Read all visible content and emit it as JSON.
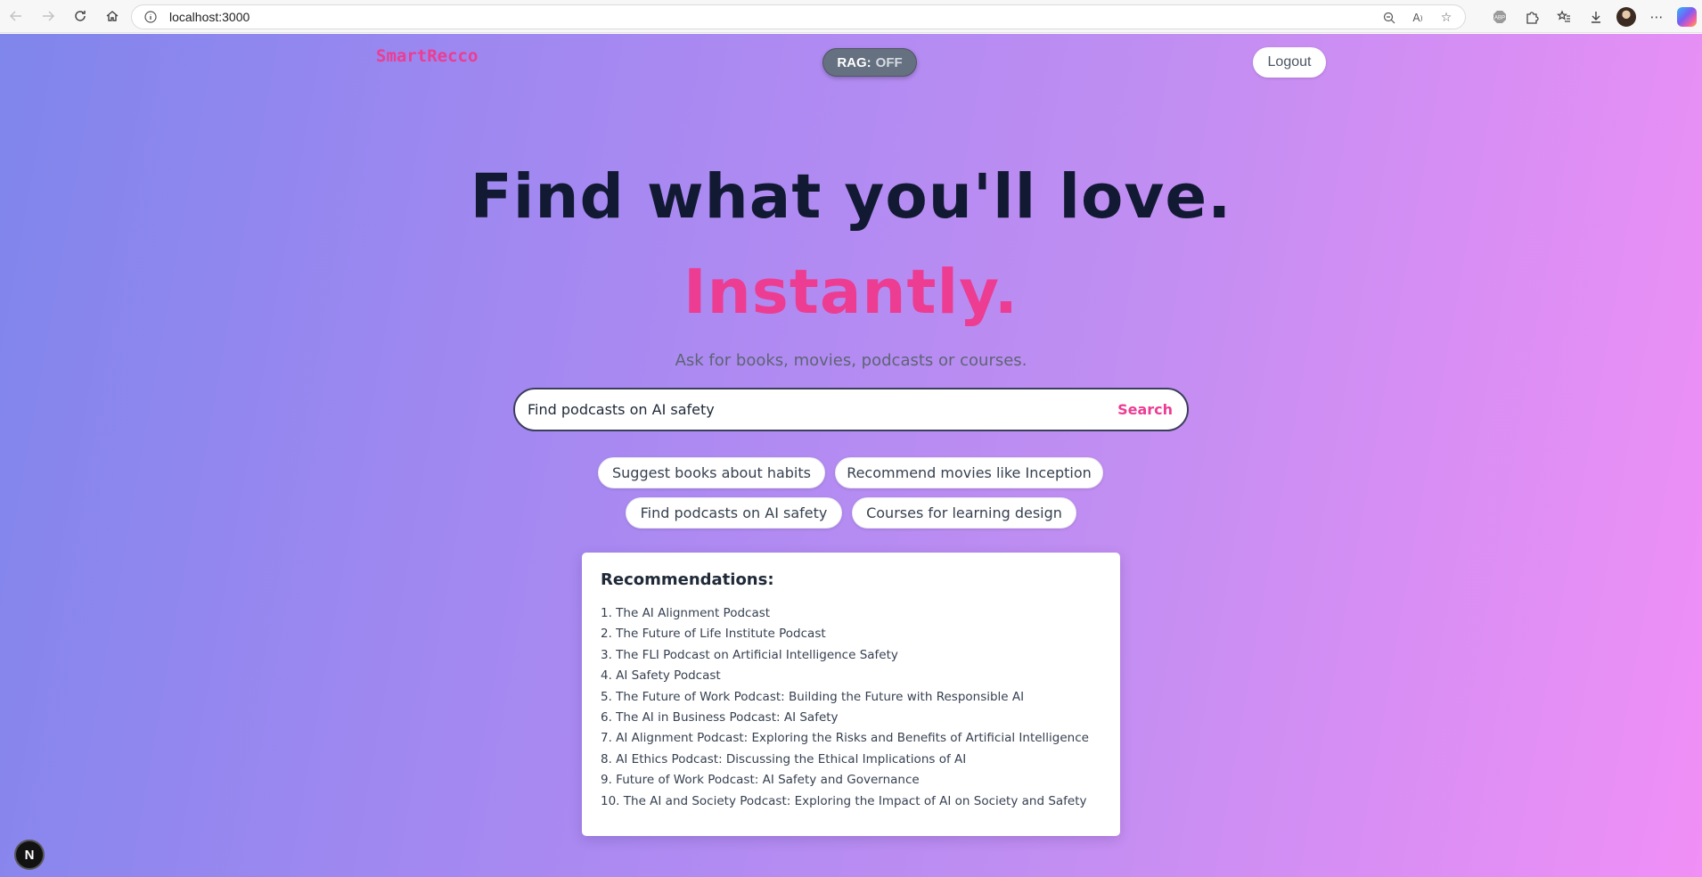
{
  "browser": {
    "url": "localhost:3000",
    "icons": {
      "back": "back-arrow-icon",
      "forward": "forward-arrow-icon",
      "refresh": "refresh-icon",
      "home": "home-icon",
      "info": "info-icon"
    }
  },
  "app": {
    "logo": "SmartRecco",
    "rag_label": "RAG:",
    "rag_state": "OFF",
    "logout_label": "Logout"
  },
  "hero": {
    "line1": "Find what you'll love.",
    "line2": "Instantly.",
    "subtitle": "Ask for books, movies, podcasts or courses."
  },
  "search": {
    "value": "Find podcasts on AI safety",
    "button_label": "Search"
  },
  "suggestions": [
    "Suggest books about habits",
    "Recommend movies like Inception",
    "Find podcasts on AI safety",
    "Courses for learning design"
  ],
  "recommendations": {
    "title": "Recommendations:",
    "items": [
      "1. The AI Alignment Podcast",
      "2. The Future of Life Institute Podcast",
      "3. The FLI Podcast on Artificial Intelligence Safety",
      "4. AI Safety Podcast",
      "5. The Future of Work Podcast: Building the Future with Responsible AI",
      "6. The AI in Business Podcast: AI Safety",
      "7. AI Alignment Podcast: Exploring the Risks and Benefits of Artificial Intelligence",
      "8. AI Ethics Podcast: Discussing the Ethical Implications of AI",
      "9. Future of Work Podcast: AI Safety and Governance",
      "10. The AI and Society Podcast: Exploring the Impact of AI on Society and Safety"
    ]
  },
  "dev_badge": "N",
  "colors": {
    "accent": "#ec3d93",
    "heading": "#121a33",
    "rag_toggle_bg": "#657080"
  }
}
